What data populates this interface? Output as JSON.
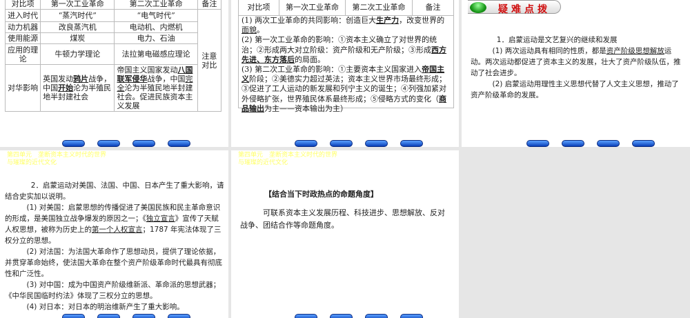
{
  "slide1": {
    "headers": [
      "对比项",
      "第一次工业革命",
      "第二次工业革命",
      "备注"
    ],
    "rows": [
      [
        "进入时代",
        "“蒸汽时代”",
        "“电气时代”"
      ],
      [
        "动力机器",
        "改良蒸汽机",
        "电动机、内燃机"
      ],
      [
        "使用能源",
        "煤炭",
        "电力、石油"
      ],
      [
        "应用的理论",
        "牛顿力学理论",
        "法拉第电磁感应理论"
      ]
    ],
    "note": "注意对比",
    "impact_label": "对华影响",
    "impact_first": [
      {
        "t": "英国发动"
      },
      {
        "t": "鸦片",
        "u": 1
      },
      {
        "t": "战争，中国"
      },
      {
        "t": "开始",
        "u": 1
      },
      {
        "t": "沦为半殖民地半封建社会"
      }
    ],
    "impact_second": [
      {
        "t": "帝国主义国家发动"
      },
      {
        "t": "八国联军侵华",
        "u": 1
      },
      {
        "t": "战争，中国"
      },
      {
        "t": "完全",
        "l": 1
      },
      {
        "t": "沦为半殖民地半封建社会。促进民族资本主义发展"
      }
    ]
  },
  "slide2": {
    "headers": [
      "对比项",
      "第一次工业革命",
      "第二次工业革命",
      "备注"
    ],
    "paras": [
      [
        {
          "t": "(1) 两次工业革命的共同影响：创造巨大"
        },
        {
          "t": "生产力",
          "u": 1
        },
        {
          "t": "，改变世界的"
        },
        {
          "t": "面貌",
          "l": 1
        },
        {
          "t": "。"
        }
      ],
      [
        {
          "t": "(2) 第一次工业革命的影响：①资本主义确立了对世界的统治；②形成两大对立阶级：资产阶级和无产阶级；③形成"
        },
        {
          "t": "西方先进、东方落后",
          "u": 1
        },
        {
          "t": "的局面。"
        }
      ],
      [
        {
          "t": "(3) 第二次工业革命的影响：①主要资本主义国家进入"
        },
        {
          "t": "帝国主义",
          "u": 1
        },
        {
          "t": "阶段；②美德实力超过英法；资本主义世界市场最终形成；③促进了工人运动的新发展和列宁主义的诞生；④列强加紧对外侵略扩张，世界殖民体系最终形成；⑤侵略方式的变化（"
        },
        {
          "t": "商品输出",
          "u": 1
        },
        {
          "t": "为主——资本输出为主）"
        }
      ]
    ]
  },
  "slide3": {
    "section_title": "疑难点拨",
    "paras": [
      [
        {
          "t": "1．启蒙运动是文艺复兴的继续和发展"
        }
      ],
      [
        {
          "t": "(1) 两次运动具有相同的性质，都是"
        },
        {
          "t": "资产阶级思想解放",
          "l": 1
        },
        {
          "t": "运动。两次运动都促进了资本主义的发展，壮大了资产阶级队伍，推动了社会进步。"
        }
      ],
      [
        {
          "t": "(2) 启蒙运动用理性主义思想代替了人文主义思想，推动了资产阶级革命的发展。"
        }
      ]
    ]
  },
  "slide4": {
    "unit_line1": "第四单元　垄断资本主义时代的世界",
    "unit_line2": "与璀璨的近代文化",
    "paras": [
      [
        {
          "t": "2．启蒙运动对美国、法国、中国、日本产生了重大影响，请结合史实加以说明。"
        }
      ],
      [
        {
          "t": "(1) 对美国：启蒙思想的传播促进了美国民族和民主革命意识的形成，是美国独立战争爆发的原因之一；《"
        },
        {
          "t": "独立宣言",
          "l": 1
        },
        {
          "t": "》宣传了天赋人权思想，被称为历史上的"
        },
        {
          "t": "第一个人权宣言",
          "l": 1
        },
        {
          "t": "；1787 年宪法体现了三权分立的思想。"
        }
      ],
      [
        {
          "t": "(2) 对法国：为法国大革命作了思想动员，提供了理论依据，并贯穿革命始终，使法国大革命在整个资产阶级革命时代最具有彻底性和广泛性。"
        }
      ],
      [
        {
          "t": "(3) 对中国：成为中国资产阶级维新派、革命派的思想武器；《中华民国临时约法》体现了三权分立的思想。"
        }
      ],
      [
        {
          "t": "(4) 对日本：对日本的明治维新产生了重大影响。"
        }
      ]
    ]
  },
  "slide5": {
    "unit_line1": "第四单元　垄断资本主义时代的世界",
    "unit_line2": "与璀璨的近代文化",
    "heading": "【结合当下时政热点的命题角度】",
    "paras": [
      [
        {
          "t": "可联系资本主义发展历程、科技进步、思想解放、反对战争、团结合作等命题角度。"
        }
      ]
    ]
  },
  "colors": {
    "accent_red": "#d01010",
    "unit_yellow": "#ffff66",
    "button_blue": "#0a3fb8"
  }
}
